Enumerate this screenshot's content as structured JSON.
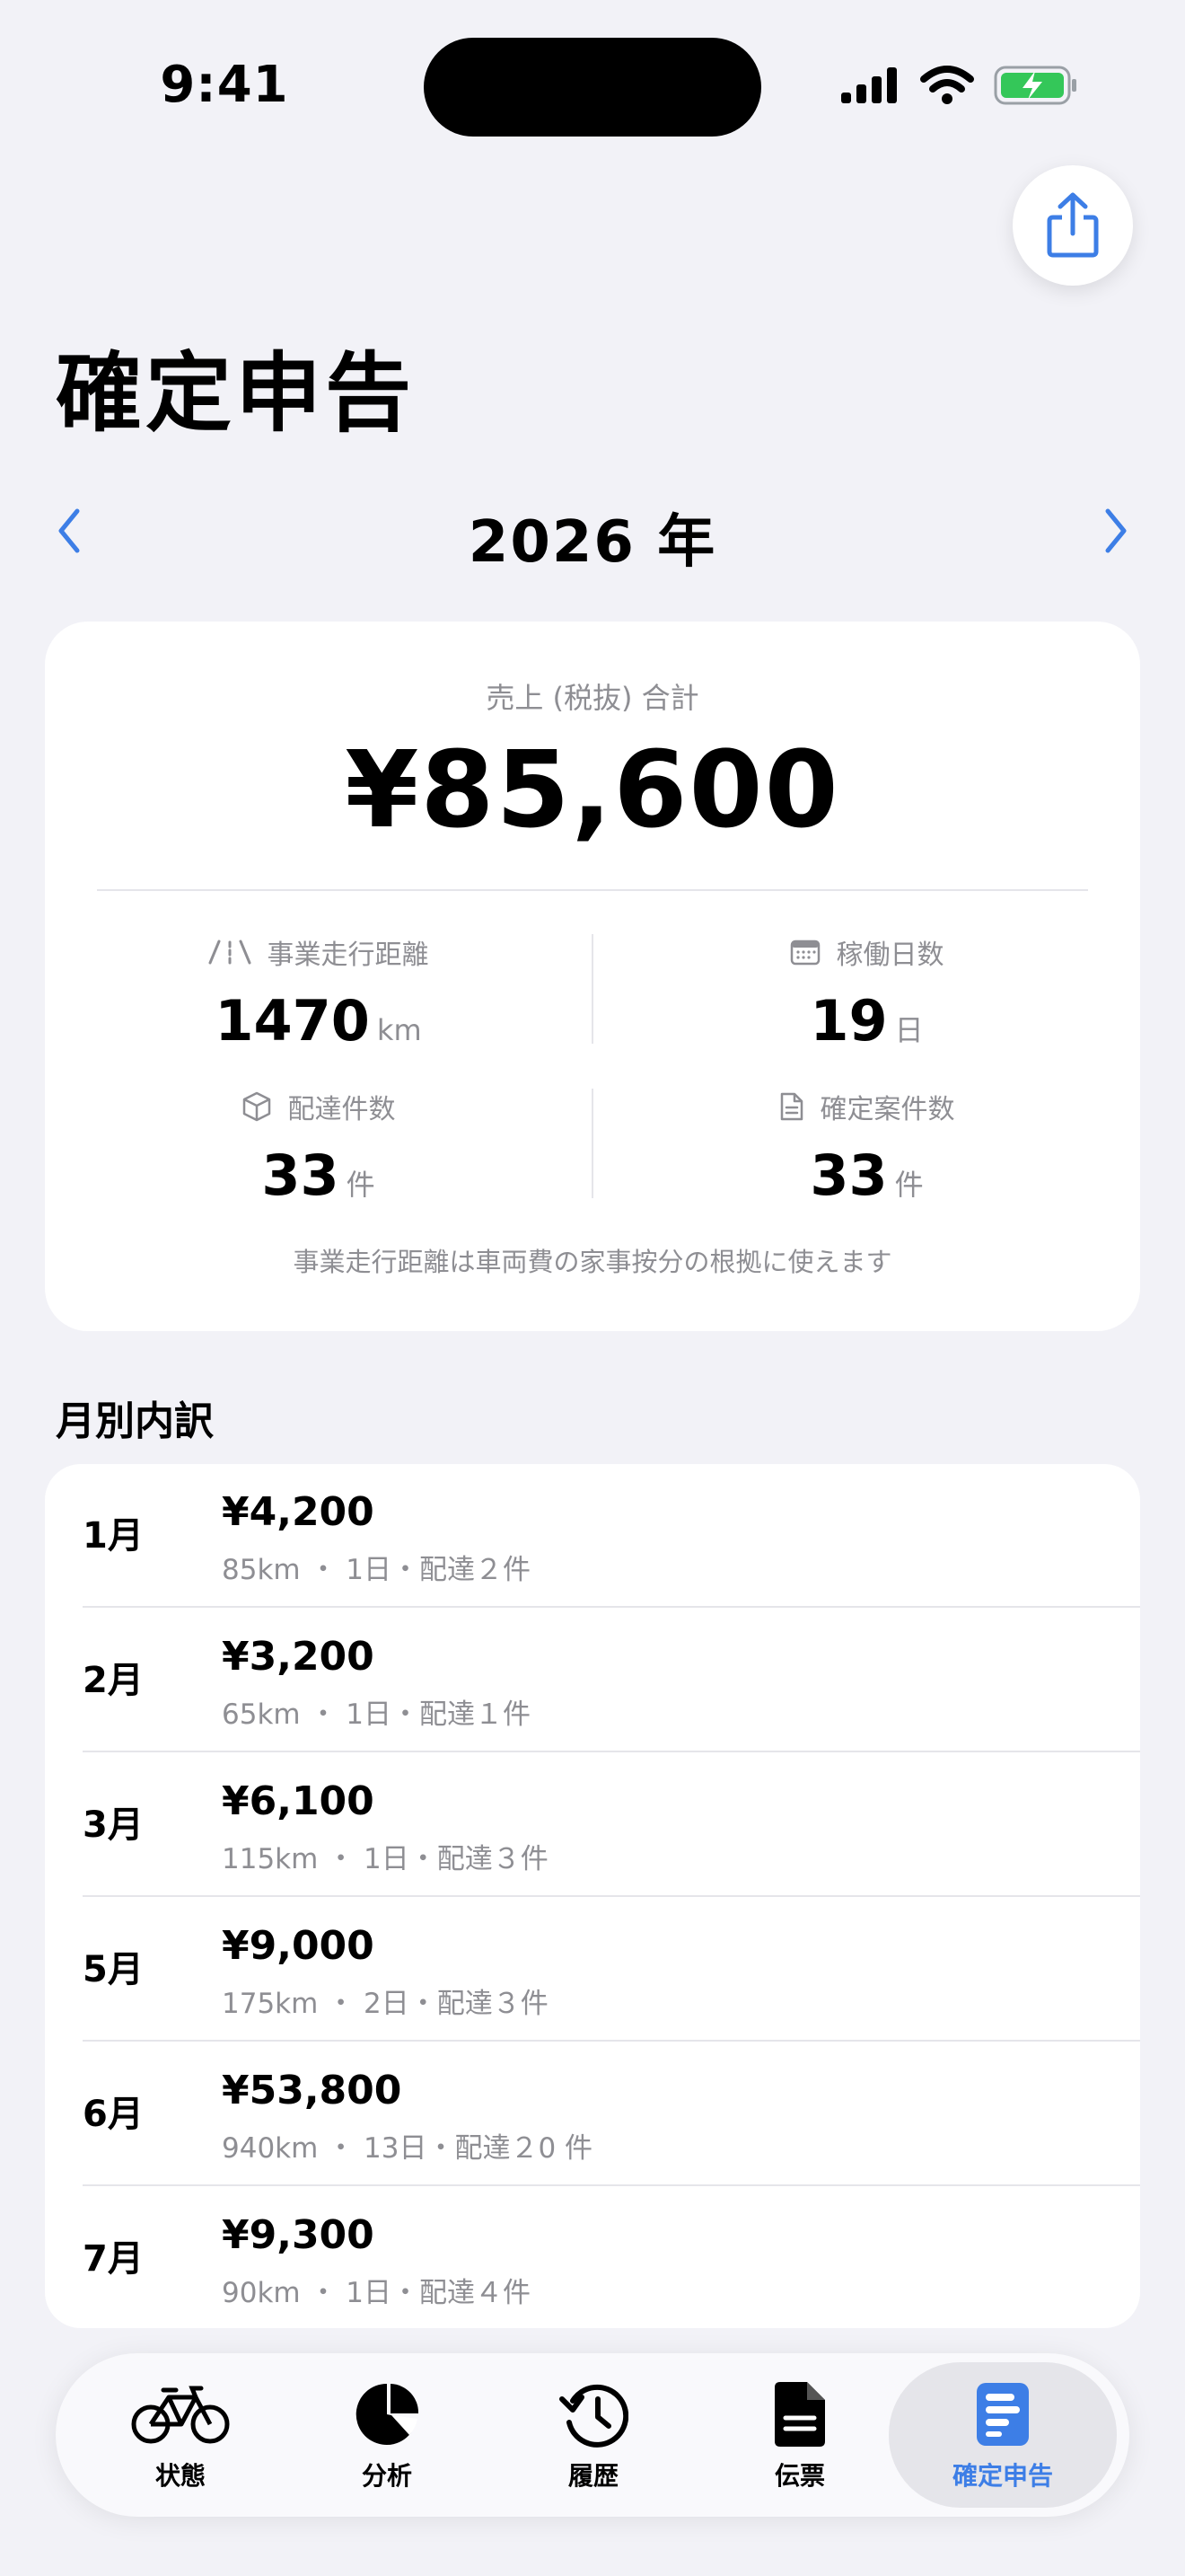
{
  "status_bar": {
    "time": "9:41"
  },
  "page_title": "確定申告",
  "year_nav": {
    "label": "2026 年"
  },
  "summary": {
    "label": "売上 (税抜) 合計",
    "total": "¥85,600",
    "stats": [
      {
        "label": "事業走行距離",
        "value": "1470",
        "unit": "km",
        "icon": "road-icon"
      },
      {
        "label": "稼働日数",
        "value": "19",
        "unit": "日",
        "icon": "calendar-icon"
      },
      {
        "label": "配達件数",
        "value": "33",
        "unit": "件",
        "icon": "box-icon"
      },
      {
        "label": "確定案件数",
        "value": "33",
        "unit": "件",
        "icon": "document-icon"
      }
    ],
    "note": "事業走行距離は車両費の家事按分の根拠に使えます"
  },
  "monthly": {
    "title": "月別内訳",
    "rows": [
      {
        "month": "1月",
        "amount": "¥4,200",
        "detail": "85km ・ 1日・配達２件"
      },
      {
        "month": "2月",
        "amount": "¥3,200",
        "detail": "65km ・ 1日・配達１件"
      },
      {
        "month": "3月",
        "amount": "¥6,100",
        "detail": "115km ・ 1日・配達３件"
      },
      {
        "month": "5月",
        "amount": "¥9,000",
        "detail": "175km ・ 2日・配達３件"
      },
      {
        "month": "6月",
        "amount": "¥53,800",
        "detail": "940km ・ 13日・配達２0 件"
      },
      {
        "month": "7月",
        "amount": "¥9,300",
        "detail": "90km ・ 1日・配達４件"
      }
    ]
  },
  "tabs": [
    {
      "label": "状態",
      "icon": "bicycle-icon"
    },
    {
      "label": "分析",
      "icon": "pie-chart-icon"
    },
    {
      "label": "履歴",
      "icon": "history-icon"
    },
    {
      "label": "伝票",
      "icon": "document-icon"
    },
    {
      "label": "確定申告",
      "icon": "tax-report-icon",
      "active": true
    }
  ],
  "colors": {
    "accent": "#3d7ee6",
    "background": "#f2f2f7",
    "secondary_text": "#8e8e93",
    "battery": "#34c759"
  }
}
